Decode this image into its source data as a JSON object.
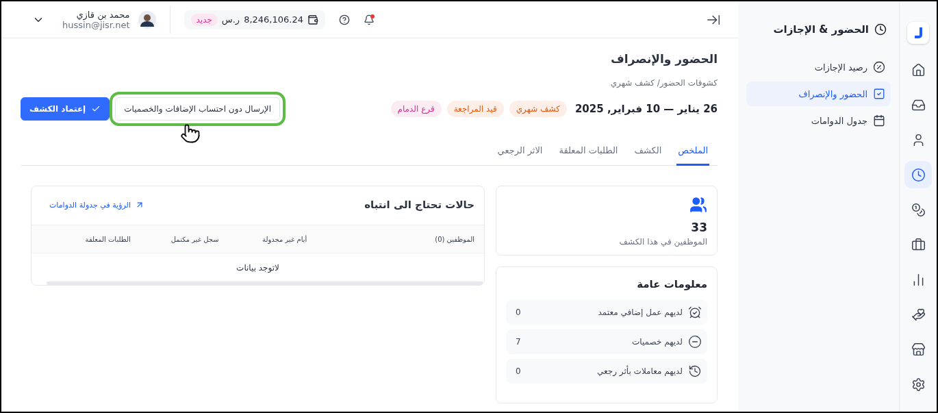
{
  "rail": {
    "items": [
      {
        "selected": false
      },
      {
        "selected": false
      },
      {
        "selected": false
      },
      {
        "selected": true
      },
      {
        "selected": false
      },
      {
        "selected": false
      },
      {
        "selected": false
      },
      {
        "selected": false
      },
      {
        "selected": false
      },
      {
        "selected": false
      }
    ]
  },
  "sidebar": {
    "title": "الحضور & الإجازات",
    "items": [
      {
        "label": "رصيد الإجازات",
        "selected": false
      },
      {
        "label": "الحضور والإنصراف",
        "selected": true
      },
      {
        "label": "جدول الدوامات",
        "selected": false
      }
    ]
  },
  "topbar": {
    "balance": "8,246,106.24",
    "currency": "ر.س",
    "balance_badge": "جديد",
    "notifications": true,
    "user": {
      "name": "محمد بن قازي",
      "email": "hussin@jisr.net"
    }
  },
  "page": {
    "title": "الحضور والإنصراف",
    "breadcrumb": "كشوفات الحضور/ كشف شهري",
    "period": "26 يناير — 10 فبراير, 2025",
    "badges": [
      {
        "label": "كشف شهري",
        "color": "#e8590c"
      },
      {
        "label": "قيد المراجعة",
        "color": "#e8590c"
      },
      {
        "label": "فرع الدمام",
        "color": "#d6338c"
      }
    ],
    "buttons": [
      {
        "label": "الإرسال دون احتساب الإضافات والخصميات",
        "kind": "secondary",
        "highlighted": true
      },
      {
        "label": "إعتماد الكشف",
        "kind": "primary",
        "highlighted": false
      }
    ],
    "tabs": [
      {
        "label": "الملخص",
        "selected": true
      },
      {
        "label": "الكشف",
        "selected": false
      },
      {
        "label": "الطلبات المعلقة",
        "selected": false
      },
      {
        "label": "الاثر الرجعي",
        "selected": false
      }
    ]
  },
  "employees_card": {
    "value": "33",
    "label": "الموظفين في هذا الكشف"
  },
  "general_info": {
    "title": "معلومات عامة",
    "rows": [
      {
        "label": "لديهم عمل إضافي معتمد",
        "value": "0"
      },
      {
        "label": "لديهم خصميات",
        "value": "7"
      },
      {
        "label": "لديهم معاملات بأثر رجعي",
        "value": "0"
      }
    ]
  },
  "attention": {
    "title": "حالات تحتاج الى انتباه",
    "link": "الرؤية في جدولة الدوامات",
    "table": {
      "columns": [
        "الموظفين (0)",
        "أيام غير مجدولة",
        "سجل غير مكتمل",
        "الطلبات المعلقة"
      ],
      "empty": "لاتوجد بيانات"
    }
  }
}
